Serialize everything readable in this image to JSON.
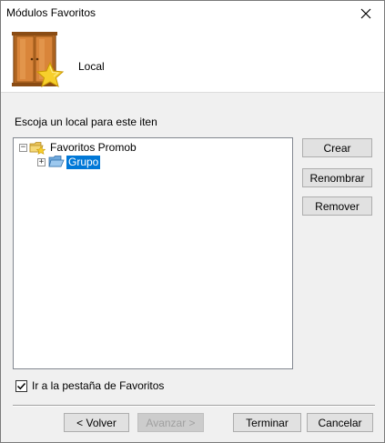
{
  "window": {
    "title": "Módulos Favoritos"
  },
  "header": {
    "label": "Local",
    "icon": "wardrobe-star-icon"
  },
  "instruction": "Escoja un local para este iten",
  "tree": {
    "items": [
      {
        "label": "Favoritos Promob",
        "expander": "−",
        "icon": "favorites-folder-icon",
        "selected": false
      },
      {
        "label": "Grupo",
        "expander": "+",
        "icon": "open-folder-icon",
        "selected": true
      }
    ]
  },
  "side_buttons": {
    "create": "Crear",
    "rename": "Renombrar",
    "remove": "Remover"
  },
  "checkbox": {
    "label": "Ir a la pestaña de Favoritos",
    "checked": true
  },
  "nav_buttons": {
    "back": "< Volver",
    "next": "Avanzar >",
    "finish": "Terminar",
    "cancel": "Cancelar"
  },
  "colors": {
    "selection": "#0078d7",
    "wood": "#c8762a",
    "star": "#f5c518"
  }
}
